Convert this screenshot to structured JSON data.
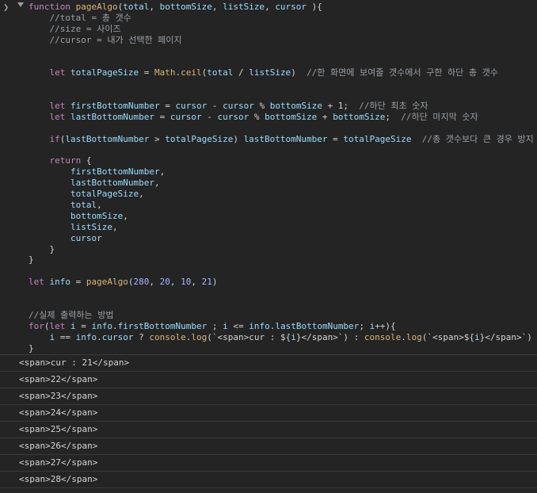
{
  "console": {
    "prompt_glyph": "❯",
    "code_lines": [
      [
        {
          "c": "kw",
          "t": "function "
        },
        {
          "c": "fn",
          "t": "pageAlgo"
        },
        {
          "c": "plain",
          "t": "("
        },
        {
          "c": "prm",
          "t": "total"
        },
        {
          "c": "plain",
          "t": ", "
        },
        {
          "c": "prm",
          "t": "bottomSize"
        },
        {
          "c": "plain",
          "t": ", "
        },
        {
          "c": "prm",
          "t": "listSize"
        },
        {
          "c": "plain",
          "t": ", "
        },
        {
          "c": "prm",
          "t": "cursor"
        },
        {
          "c": "plain",
          "t": " ){"
        }
      ],
      [
        {
          "c": "cmt",
          "t": "    //total = 총 갯수"
        }
      ],
      [
        {
          "c": "cmt",
          "t": "    //size = 사이즈"
        }
      ],
      [
        {
          "c": "cmt",
          "t": "    //cursor = 내가 선택한 페이지"
        }
      ],
      [
        {
          "c": "plain",
          "t": ""
        }
      ],
      [
        {
          "c": "plain",
          "t": ""
        }
      ],
      [
        {
          "c": "kw",
          "t": "    let "
        },
        {
          "c": "var",
          "t": "totalPageSize"
        },
        {
          "c": "plain",
          "t": " = "
        },
        {
          "c": "fn",
          "t": "Math"
        },
        {
          "c": "plain",
          "t": "."
        },
        {
          "c": "fn",
          "t": "ceil"
        },
        {
          "c": "plain",
          "t": "("
        },
        {
          "c": "var",
          "t": "total"
        },
        {
          "c": "plain",
          "t": " / "
        },
        {
          "c": "var",
          "t": "listSize"
        },
        {
          "c": "plain",
          "t": ")  "
        },
        {
          "c": "cmt",
          "t": "//한 화면에 보여줄 갯수에서 구한 하단 총 갯수"
        }
      ],
      [
        {
          "c": "plain",
          "t": ""
        }
      ],
      [
        {
          "c": "plain",
          "t": ""
        }
      ],
      [
        {
          "c": "kw",
          "t": "    let "
        },
        {
          "c": "var",
          "t": "firstBottomNumber"
        },
        {
          "c": "plain",
          "t": " = "
        },
        {
          "c": "var",
          "t": "cursor"
        },
        {
          "c": "plain",
          "t": " - "
        },
        {
          "c": "var",
          "t": "cursor"
        },
        {
          "c": "plain",
          "t": " % "
        },
        {
          "c": "var",
          "t": "bottomSize"
        },
        {
          "c": "plain",
          "t": " + 1;  "
        },
        {
          "c": "cmt",
          "t": "//하단 최초 숫자"
        }
      ],
      [
        {
          "c": "kw",
          "t": "    let "
        },
        {
          "c": "var",
          "t": "lastBottomNumber"
        },
        {
          "c": "plain",
          "t": " = "
        },
        {
          "c": "var",
          "t": "cursor"
        },
        {
          "c": "plain",
          "t": " - "
        },
        {
          "c": "var",
          "t": "cursor"
        },
        {
          "c": "plain",
          "t": " % "
        },
        {
          "c": "var",
          "t": "bottomSize"
        },
        {
          "c": "plain",
          "t": " + "
        },
        {
          "c": "var",
          "t": "bottomSize"
        },
        {
          "c": "plain",
          "t": ";  "
        },
        {
          "c": "cmt",
          "t": "//하단 마지막 숫자"
        }
      ],
      [
        {
          "c": "plain",
          "t": ""
        }
      ],
      [
        {
          "c": "kw",
          "t": "    if"
        },
        {
          "c": "plain",
          "t": "("
        },
        {
          "c": "var",
          "t": "lastBottomNumber"
        },
        {
          "c": "plain",
          "t": " > "
        },
        {
          "c": "var",
          "t": "totalPageSize"
        },
        {
          "c": "plain",
          "t": ") "
        },
        {
          "c": "var",
          "t": "lastBottomNumber"
        },
        {
          "c": "plain",
          "t": " = "
        },
        {
          "c": "var",
          "t": "totalPageSize"
        },
        {
          "c": "plain",
          "t": "  "
        },
        {
          "c": "cmt",
          "t": "//총 갯수보다 큰 경우 방지"
        }
      ],
      [
        {
          "c": "plain",
          "t": ""
        }
      ],
      [
        {
          "c": "kw",
          "t": "    return"
        },
        {
          "c": "plain",
          "t": " {"
        }
      ],
      [
        {
          "c": "var",
          "t": "        firstBottomNumber"
        },
        {
          "c": "plain",
          "t": ","
        }
      ],
      [
        {
          "c": "var",
          "t": "        lastBottomNumber"
        },
        {
          "c": "plain",
          "t": ","
        }
      ],
      [
        {
          "c": "var",
          "t": "        totalPageSize"
        },
        {
          "c": "plain",
          "t": ","
        }
      ],
      [
        {
          "c": "var",
          "t": "        total"
        },
        {
          "c": "plain",
          "t": ","
        }
      ],
      [
        {
          "c": "var",
          "t": "        bottomSize"
        },
        {
          "c": "plain",
          "t": ","
        }
      ],
      [
        {
          "c": "var",
          "t": "        listSize"
        },
        {
          "c": "plain",
          "t": ","
        }
      ],
      [
        {
          "c": "var",
          "t": "        cursor"
        }
      ],
      [
        {
          "c": "plain",
          "t": "    }"
        }
      ],
      [
        {
          "c": "plain",
          "t": "}"
        }
      ],
      [
        {
          "c": "plain",
          "t": ""
        }
      ],
      [
        {
          "c": "kw",
          "t": "let "
        },
        {
          "c": "var",
          "t": "info"
        },
        {
          "c": "plain",
          "t": " = "
        },
        {
          "c": "fn",
          "t": "pageAlgo"
        },
        {
          "c": "plain",
          "t": "("
        },
        {
          "c": "num2",
          "t": "280"
        },
        {
          "c": "plain",
          "t": ", "
        },
        {
          "c": "num2",
          "t": "20"
        },
        {
          "c": "plain",
          "t": ", "
        },
        {
          "c": "num2",
          "t": "10"
        },
        {
          "c": "plain",
          "t": ", "
        },
        {
          "c": "num2",
          "t": "21"
        },
        {
          "c": "plain",
          "t": ")"
        }
      ],
      [
        {
          "c": "plain",
          "t": ""
        }
      ],
      [
        {
          "c": "plain",
          "t": ""
        }
      ],
      [
        {
          "c": "cmt",
          "t": "//실제 출력하는 방법"
        }
      ],
      [
        {
          "c": "kw",
          "t": "for"
        },
        {
          "c": "plain",
          "t": "("
        },
        {
          "c": "kw",
          "t": "let "
        },
        {
          "c": "var",
          "t": "i"
        },
        {
          "c": "plain",
          "t": " = "
        },
        {
          "c": "var",
          "t": "info"
        },
        {
          "c": "plain",
          "t": "."
        },
        {
          "c": "var",
          "t": "firstBottomNumber"
        },
        {
          "c": "plain",
          "t": " ; "
        },
        {
          "c": "var",
          "t": "i"
        },
        {
          "c": "plain",
          "t": " <= "
        },
        {
          "c": "var",
          "t": "info"
        },
        {
          "c": "plain",
          "t": "."
        },
        {
          "c": "var",
          "t": "lastBottomNumber"
        },
        {
          "c": "plain",
          "t": "; "
        },
        {
          "c": "var",
          "t": "i"
        },
        {
          "c": "plain",
          "t": "++){"
        }
      ],
      [
        {
          "c": "var",
          "t": "    i"
        },
        {
          "c": "plain",
          "t": " == "
        },
        {
          "c": "var",
          "t": "info"
        },
        {
          "c": "plain",
          "t": "."
        },
        {
          "c": "var",
          "t": "cursor"
        },
        {
          "c": "plain",
          "t": " ? "
        },
        {
          "c": "fn",
          "t": "console"
        },
        {
          "c": "plain",
          "t": "."
        },
        {
          "c": "fn",
          "t": "log"
        },
        {
          "c": "plain",
          "t": "(`<span>cur : ${"
        },
        {
          "c": "var",
          "t": "i"
        },
        {
          "c": "plain",
          "t": "}</span>`) : "
        },
        {
          "c": "fn",
          "t": "console"
        },
        {
          "c": "plain",
          "t": "."
        },
        {
          "c": "fn",
          "t": "log"
        },
        {
          "c": "plain",
          "t": "(`<span>${"
        },
        {
          "c": "var",
          "t": "i"
        },
        {
          "c": "plain",
          "t": "}</span>`)"
        }
      ],
      [
        {
          "c": "plain",
          "t": "}"
        }
      ]
    ],
    "log_rows": [
      "<span>cur : 21</span>",
      "<span>22</span>",
      "<span>23</span>",
      "<span>24</span>",
      "<span>25</span>",
      "<span>26</span>",
      "<span>27</span>",
      "<span>28</span>"
    ]
  }
}
